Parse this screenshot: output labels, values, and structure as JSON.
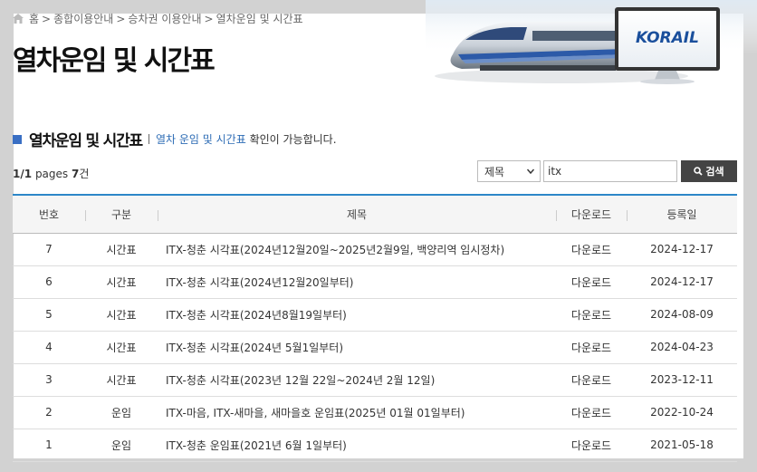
{
  "breadcrumb": {
    "items": [
      "홈",
      "종합이용안내",
      "승차권 이용안내",
      "열차운임 및 시간표"
    ],
    "separator": ">"
  },
  "page_title": "열차운임 및 시간표",
  "banner": {
    "logo_text": "KORAIL"
  },
  "section": {
    "title": "열차운임 및 시간표",
    "desc_link": "열차 운임 및 시간표",
    "desc_suffix": "확인이 가능합니다."
  },
  "pager": {
    "current": "1",
    "total": "1",
    "pages_label": "pages",
    "count": "7",
    "count_unit": "건"
  },
  "search": {
    "select_value": "제목",
    "input_value": "itx",
    "button_label": "검색"
  },
  "table": {
    "headers": [
      "번호",
      "구분",
      "제목",
      "다운로드",
      "등록일"
    ],
    "rows": [
      {
        "num": "7",
        "type": "시간표",
        "title": "ITX-청춘 시각표(2024년12월20일~2025년2월9일, 백양리역 임시정차)",
        "download": "다운로드",
        "date": "2024-12-17"
      },
      {
        "num": "6",
        "type": "시간표",
        "title": "ITX-청춘 시각표(2024년12월20일부터)",
        "download": "다운로드",
        "date": "2024-12-17"
      },
      {
        "num": "5",
        "type": "시간표",
        "title": "ITX-청춘 시각표(2024년8월19일부터)",
        "download": "다운로드",
        "date": "2024-08-09"
      },
      {
        "num": "4",
        "type": "시간표",
        "title": "ITX-청춘 시각표(2024년 5월1일부터)",
        "download": "다운로드",
        "date": "2024-04-23"
      },
      {
        "num": "3",
        "type": "시간표",
        "title": "ITX-청춘 시각표(2023년 12월 22일~2024년 2월 12일)",
        "download": "다운로드",
        "date": "2023-12-11"
      },
      {
        "num": "2",
        "type": "운임",
        "title": "ITX-마음, ITX-새마을, 새마을호 운임표(2025년 01월 01일부터)",
        "download": "다운로드",
        "date": "2022-10-24"
      },
      {
        "num": "1",
        "type": "운임",
        "title": "ITX-청춘 운임표(2021년 6월 1일부터)",
        "download": "다운로드",
        "date": "2021-05-18"
      }
    ]
  },
  "colors": {
    "accent_blue": "#2d87c8",
    "section_marker": "#3a6fc4",
    "link": "#2d6cb5",
    "button_bg": "#444444"
  }
}
